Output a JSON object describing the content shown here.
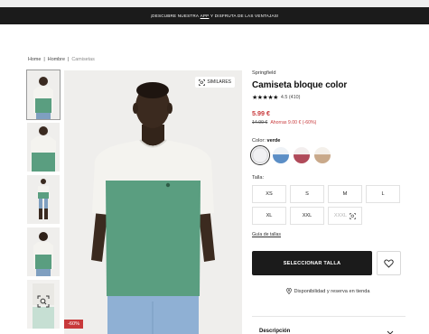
{
  "promo": {
    "prefix": "¡DESCUBRE NUESTRA",
    "app": "APP",
    "suffix": "Y DISFRUTA DE LAS VENTAJAS!"
  },
  "breadcrumb": {
    "home": "Home",
    "sep1": "|",
    "hombre": "Hombre",
    "sep2": "|",
    "current": "Camisetas"
  },
  "gallery": {
    "similares_label": "SIMILARES",
    "discount_badge": "-60%",
    "thumbnails": [
      "front",
      "front-close",
      "full-body",
      "back",
      "scan"
    ]
  },
  "product": {
    "brand": "Springfield",
    "title": "Camiseta bloque color",
    "stars": "★★★★★",
    "rating": "4.5 (410)",
    "price": "5.99 €",
    "old_price": "14.99 €",
    "savings": "Ahorras 9.00 € (-60%)",
    "color_label": "Color:",
    "color_value": "verde",
    "swatches": [
      {
        "name": "white",
        "color": "#e8e8ea",
        "selected": true
      },
      {
        "name": "blue-white",
        "color": "#5b8ec6",
        "selected": false
      },
      {
        "name": "burgundy-white",
        "color": "#b04a5a",
        "selected": false
      },
      {
        "name": "beige-white",
        "color": "#c9a98a",
        "selected": false
      }
    ],
    "size_label": "Talla:",
    "sizes": [
      "XS",
      "S",
      "M",
      "L",
      "XL",
      "XXL",
      "XXXL"
    ],
    "size_guide": "Guía de tallas",
    "add_button": "SELECCIONAR TALLA",
    "store_text": "Disponibilidad y reserva en tienda",
    "description_label": "Descripción"
  },
  "colors": {
    "accent_red": "#c8393b",
    "dark": "#1b1b1b",
    "shirt_green": "#5a9e80",
    "shirt_white": "#f4f3ef"
  }
}
